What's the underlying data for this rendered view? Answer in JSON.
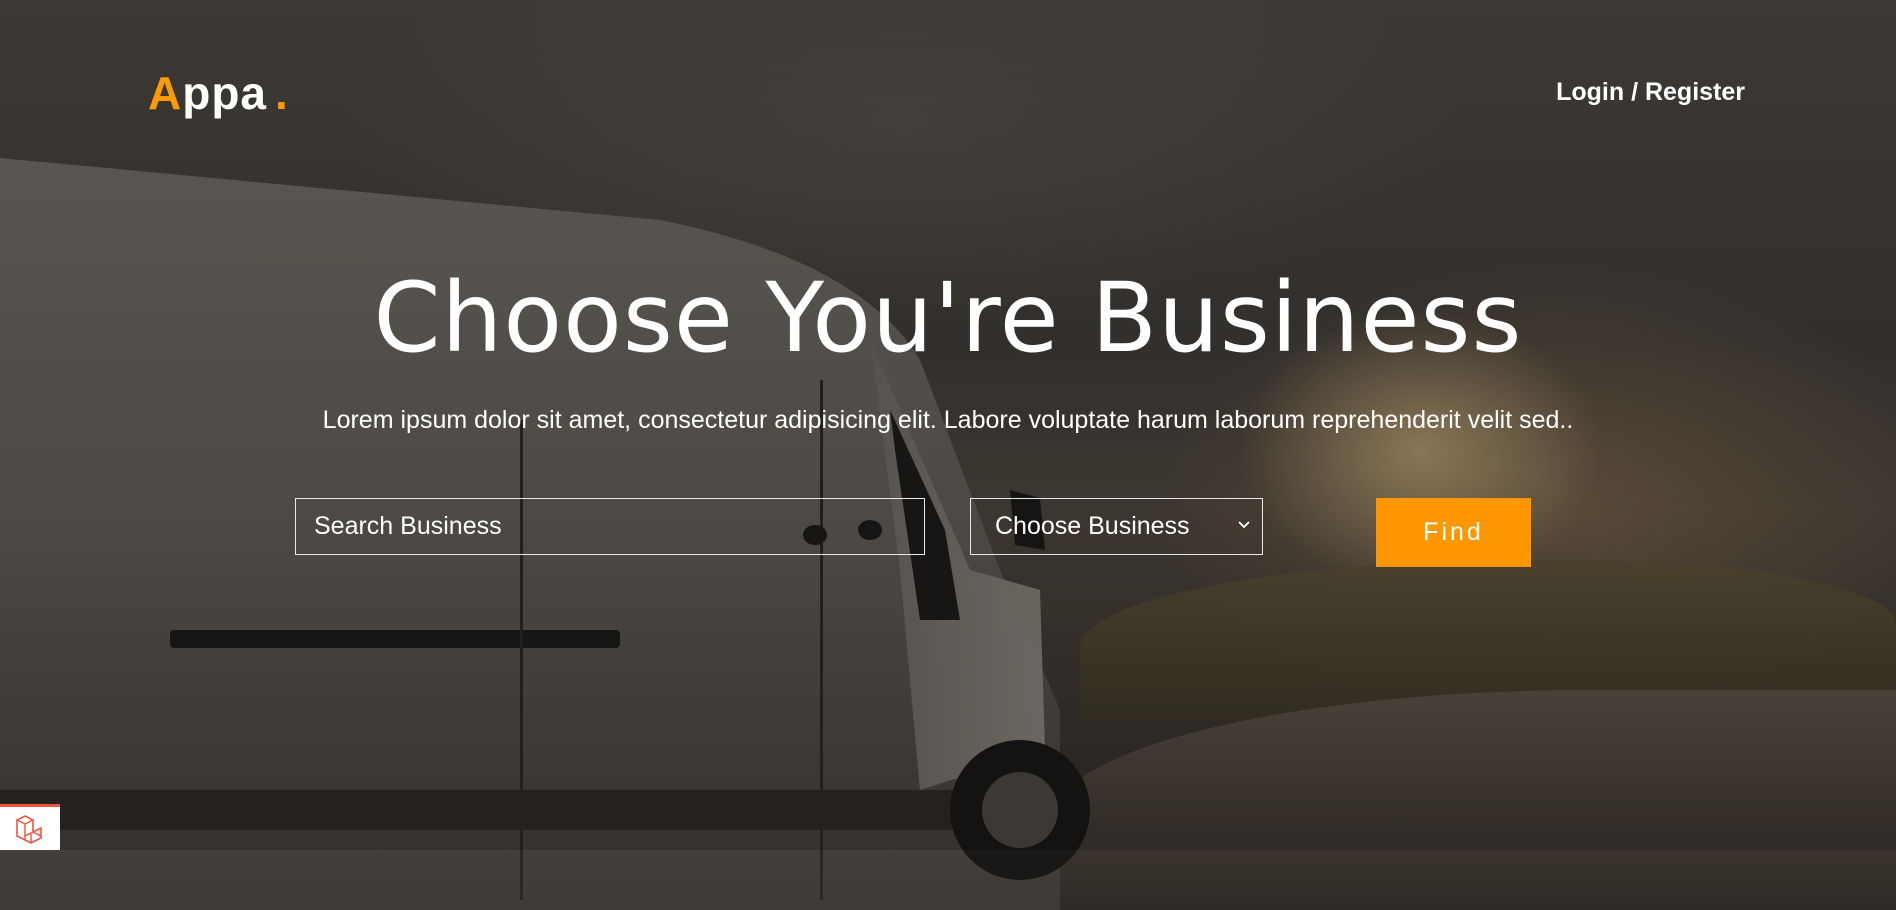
{
  "brand": {
    "logo_first": "A",
    "logo_rest": "ppa",
    "logo_dot": ".",
    "accent_color": "#ff9a00"
  },
  "nav": {
    "auth_link": "Login / Register"
  },
  "hero": {
    "title": "Choose You're Business",
    "subtitle": "Lorem ipsum dolor sit amet, consectetur adipisicing elit. Labore voluptate harum laborum reprehenderit velit sed..",
    "search": {
      "placeholder": "Search Business",
      "value": ""
    },
    "category_select": {
      "selected": "Choose Business",
      "icon": "chevron-down-icon"
    },
    "find_button": "Find",
    "button_color": "#ff9800"
  },
  "badge": {
    "icon": "laravel-icon"
  }
}
